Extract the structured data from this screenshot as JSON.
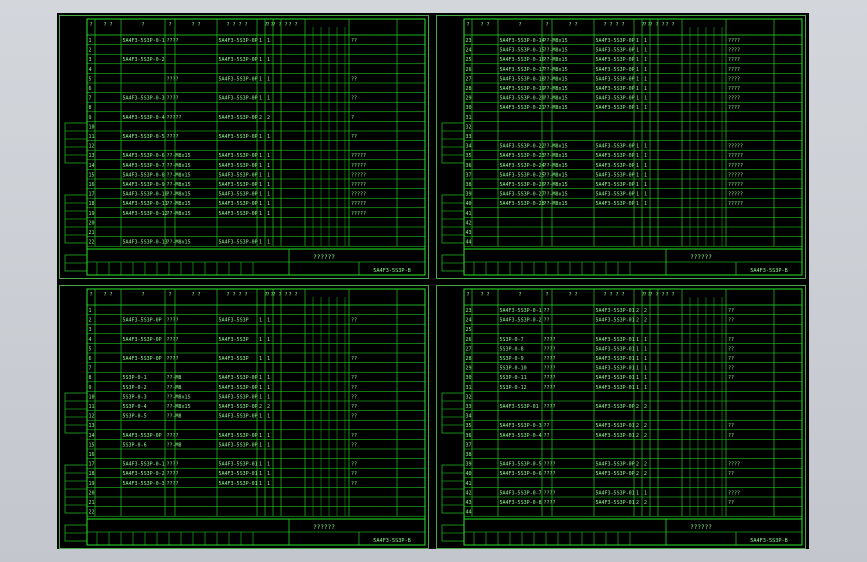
{
  "app": {
    "background_color": "#c7cbd1",
    "canvas_color": "#000000",
    "line_color": "#27e827",
    "text_color": "#8cff8c",
    "frame_color": "#4aa84a"
  },
  "sheets": [
    {
      "id": "top-left",
      "title_code": "??????",
      "drawing_no": "5A4F3-5S3P-B",
      "header": [
        "?",
        "? ?",
        "?",
        "?",
        "? ?",
        "? ? ? ?",
        "",
        "? ?",
        "? ? ? ?",
        "? ?"
      ],
      "rows": [
        {
          "n": "1",
          "code": "5A4F3-5S3P-0-1",
          "qty1": "????",
          "mat": "5A4F3-5S3P-0P",
          "a": "1",
          "b": "1",
          "note": "??"
        },
        {
          "n": "2",
          "code": "",
          "qty1": "",
          "mat": "",
          "a": "",
          "b": "",
          "note": ""
        },
        {
          "n": "3",
          "code": "5A4F3-5S3P-0-2",
          "qty1": "",
          "mat": "5A4F3-5S3P-0P",
          "a": "1",
          "b": "1",
          "note": ""
        },
        {
          "n": "4",
          "code": "",
          "qty1": "",
          "mat": "",
          "a": "",
          "b": "",
          "note": ""
        },
        {
          "n": "5",
          "code": "",
          "qty1": "????",
          "mat": "5A4F3-5S3P-0P",
          "a": "1",
          "b": "1",
          "note": "??"
        },
        {
          "n": "6",
          "code": "",
          "qty1": "",
          "mat": "",
          "a": "",
          "b": "",
          "note": ""
        },
        {
          "n": "7",
          "code": "5A4F3-5S3P-0-3",
          "qty1": "????",
          "mat": "5A4F3-5S3P-0P",
          "a": "1",
          "b": "1",
          "note": "??"
        },
        {
          "n": "8",
          "code": "",
          "qty1": "",
          "mat": "",
          "a": "",
          "b": "",
          "note": ""
        },
        {
          "n": "9",
          "code": "5A4F3-5S3P-0-4",
          "qty1": "?????",
          "mat": "5A4F3-5S3P-0P",
          "a": "2",
          "b": "2",
          "note": "?"
        },
        {
          "n": "10",
          "code": "",
          "qty1": "",
          "mat": "",
          "a": "",
          "b": "",
          "note": ""
        },
        {
          "n": "11",
          "code": "5A4F3-5S3P-0-5",
          "qty1": "????",
          "mat": "5A4F3-5S3P-0P",
          "a": "1",
          "b": "1",
          "note": "??"
        },
        {
          "n": "12",
          "code": "",
          "qty1": "",
          "mat": "",
          "a": "",
          "b": "",
          "note": ""
        },
        {
          "n": "13",
          "code": "5A4F3-5S3P-0-6",
          "qty1": "??-M8x15",
          "mat": "5A4F3-5S3P-0P",
          "a": "1",
          "b": "1",
          "note": "?????"
        },
        {
          "n": "14",
          "code": "5A4F3-5S3P-0-7",
          "qty1": "??-M8x15",
          "mat": "5A4F3-5S3P-0P",
          "a": "1",
          "b": "1",
          "note": "?????"
        },
        {
          "n": "15",
          "code": "5A4F3-5S3P-0-8",
          "qty1": "??-M8x15",
          "mat": "5A4F3-5S3P-0P",
          "a": "1",
          "b": "1",
          "note": "?????"
        },
        {
          "n": "16",
          "code": "5A4F3-5S3P-0-9",
          "qty1": "??-M8x15",
          "mat": "5A4F3-5S3P-0P",
          "a": "1",
          "b": "1",
          "note": "?????"
        },
        {
          "n": "17",
          "code": "5A4F3-5S3P-0-10",
          "qty1": "??-M8x15",
          "mat": "5A4F3-5S3P-0P",
          "a": "1",
          "b": "1",
          "note": "?????"
        },
        {
          "n": "18",
          "code": "5A4F3-5S3P-0-11",
          "qty1": "??-M8x15",
          "mat": "5A4F3-5S3P-0P",
          "a": "1",
          "b": "1",
          "note": "?????"
        },
        {
          "n": "19",
          "code": "5A4F3-5S3P-0-12",
          "qty1": "??-M8x15",
          "mat": "5A4F3-5S3P-0P",
          "a": "1",
          "b": "1",
          "note": "?????"
        },
        {
          "n": "20",
          "code": "",
          "qty1": "",
          "mat": "",
          "a": "",
          "b": "",
          "note": ""
        },
        {
          "n": "21",
          "code": "",
          "qty1": "",
          "mat": "",
          "a": "",
          "b": "",
          "note": ""
        },
        {
          "n": "22",
          "code": "5A4F3-5S3P-0-13",
          "qty1": "??-M8x15",
          "mat": "5A4F3-5S3P-0P",
          "a": "1",
          "b": "1",
          "note": ""
        }
      ]
    },
    {
      "id": "top-right",
      "title_code": "??????",
      "drawing_no": "5A4F3-5S3P-B",
      "header": [
        "?",
        "? ?",
        "?",
        "?",
        "? ?",
        "? ? ? ?",
        "",
        "? ?",
        "? ? ? ?",
        "? ?"
      ],
      "rows": [
        {
          "n": "23",
          "code": "5A4F3-5S3P-0-14",
          "qty1": "??-M8x15",
          "mat": "5A4F3-5S3P-0P",
          "a": "1",
          "b": "1",
          "note": "????"
        },
        {
          "n": "24",
          "code": "5A4F3-5S3P-0-15",
          "qty1": "??-M8x15",
          "mat": "5A4F3-5S3P-0P",
          "a": "1",
          "b": "1",
          "note": "????"
        },
        {
          "n": "25",
          "code": "5A4F3-5S3P-0-16",
          "qty1": "??-M8x15",
          "mat": "5A4F3-5S3P-0P",
          "a": "1",
          "b": "1",
          "note": "????"
        },
        {
          "n": "26",
          "code": "5A4F3-5S3P-0-17",
          "qty1": "??-M8x15",
          "mat": "5A4F3-5S3P-0P",
          "a": "1",
          "b": "1",
          "note": "????"
        },
        {
          "n": "27",
          "code": "5A4F3-5S3P-0-18",
          "qty1": "??-M8x15",
          "mat": "5A4F3-5S3P-0P",
          "a": "1",
          "b": "1",
          "note": "????"
        },
        {
          "n": "28",
          "code": "5A4F3-5S3P-0-19",
          "qty1": "??-M8x15",
          "mat": "5A4F3-5S3P-0P",
          "a": "1",
          "b": "1",
          "note": "????"
        },
        {
          "n": "29",
          "code": "5A4F3-5S3P-0-20",
          "qty1": "??-M8x15",
          "mat": "5A4F3-5S3P-0P",
          "a": "1",
          "b": "1",
          "note": "????"
        },
        {
          "n": "30",
          "code": "5A4F3-5S3P-0-21",
          "qty1": "??-M8x15",
          "mat": "5A4F3-5S3P-0P",
          "a": "1",
          "b": "1",
          "note": "????"
        },
        {
          "n": "31",
          "code": "",
          "qty1": "",
          "mat": "",
          "a": "",
          "b": "",
          "note": ""
        },
        {
          "n": "32",
          "code": "",
          "qty1": "",
          "mat": "",
          "a": "",
          "b": "",
          "note": ""
        },
        {
          "n": "33",
          "code": "",
          "qty1": "",
          "mat": "",
          "a": "",
          "b": "",
          "note": ""
        },
        {
          "n": "34",
          "code": "5A4F3-5S3P-0-22",
          "qty1": "??-M8x15",
          "mat": "5A4F3-5S3P-0P",
          "a": "1",
          "b": "1",
          "note": "?????"
        },
        {
          "n": "35",
          "code": "5A4F3-5S3P-0-23",
          "qty1": "??-M8x15",
          "mat": "5A4F3-5S3P-0P",
          "a": "1",
          "b": "1",
          "note": "?????"
        },
        {
          "n": "36",
          "code": "5A4F3-5S3P-0-24",
          "qty1": "??-M8x15",
          "mat": "5A4F3-5S3P-0P",
          "a": "1",
          "b": "1",
          "note": "?????"
        },
        {
          "n": "37",
          "code": "5A4F3-5S3P-0-25",
          "qty1": "??-M8x15",
          "mat": "5A4F3-5S3P-0P",
          "a": "1",
          "b": "1",
          "note": "?????"
        },
        {
          "n": "38",
          "code": "5A4F3-5S3P-0-26",
          "qty1": "??-M8x15",
          "mat": "5A4F3-5S3P-0P",
          "a": "1",
          "b": "1",
          "note": "?????"
        },
        {
          "n": "39",
          "code": "5A4F3-5S3P-0-27",
          "qty1": "??-M8x15",
          "mat": "5A4F3-5S3P-0P",
          "a": "1",
          "b": "1",
          "note": "?????"
        },
        {
          "n": "40",
          "code": "5A4F3-5S3P-0-28",
          "qty1": "??-M8x15",
          "mat": "5A4F3-5S3P-0P",
          "a": "1",
          "b": "1",
          "note": "?????"
        },
        {
          "n": "41",
          "code": "",
          "qty1": "",
          "mat": "",
          "a": "",
          "b": "",
          "note": ""
        },
        {
          "n": "42",
          "code": "",
          "qty1": "",
          "mat": "",
          "a": "",
          "b": "",
          "note": ""
        },
        {
          "n": "43",
          "code": "",
          "qty1": "",
          "mat": "",
          "a": "",
          "b": "",
          "note": ""
        },
        {
          "n": "44",
          "code": "",
          "qty1": "",
          "mat": "",
          "a": "",
          "b": "",
          "note": ""
        }
      ]
    },
    {
      "id": "bottom-left",
      "title_code": "??????",
      "drawing_no": "5A4F3-5S3P-B",
      "header": [
        "?",
        "? ?",
        "?",
        "?",
        "? ?",
        "? ? ? ?",
        "",
        "? ?",
        "? ? ? ?",
        "? ?"
      ],
      "rows": [
        {
          "n": "1",
          "code": "",
          "qty1": "",
          "mat": "",
          "a": "",
          "b": "",
          "note": ""
        },
        {
          "n": "2",
          "code": "5A4F3-5S3P-0P",
          "qty1": "????",
          "mat": "5A4F3-5S3P",
          "a": "1",
          "b": "1",
          "note": "??"
        },
        {
          "n": "3",
          "code": "",
          "qty1": "",
          "mat": "",
          "a": "",
          "b": "",
          "note": ""
        },
        {
          "n": "4",
          "code": "5A4F3-5S3P-0P",
          "qty1": "????",
          "mat": "5A4F3-5S3P",
          "a": "1",
          "b": "1",
          "note": ""
        },
        {
          "n": "5",
          "code": "",
          "qty1": "",
          "mat": "",
          "a": "",
          "b": "",
          "note": ""
        },
        {
          "n": "6",
          "code": "5A4F3-5S3P-0P",
          "qty1": "????",
          "mat": "5A4F3-5S3P",
          "a": "1",
          "b": "1",
          "note": "??"
        },
        {
          "n": "7",
          "code": "",
          "qty1": "",
          "mat": "",
          "a": "",
          "b": "",
          "note": ""
        },
        {
          "n": "8",
          "code": "5S3P-0-1",
          "qty1": "??-M8",
          "mat": "5A4F3-5S3P-0P",
          "a": "1",
          "b": "1",
          "note": "??"
        },
        {
          "n": "9",
          "code": "5S3P-0-2",
          "qty1": "??-M8",
          "mat": "5A4F3-5S3P-0P",
          "a": "1",
          "b": "1",
          "note": "??"
        },
        {
          "n": "10",
          "code": "5S3P-0-3",
          "qty1": "??-M8x15",
          "mat": "5A4F3-5S3P-0P",
          "a": "1",
          "b": "1",
          "note": "??"
        },
        {
          "n": "11",
          "code": "5S3P-0-4",
          "qty1": "??-M8x15",
          "mat": "5A4F3-5S3P-0P",
          "a": "2",
          "b": "2",
          "note": "??"
        },
        {
          "n": "12",
          "code": "5S3P-0-5",
          "qty1": "??-M8",
          "mat": "5A4F3-5S3P-0P",
          "a": "1",
          "b": "1",
          "note": "??"
        },
        {
          "n": "13",
          "code": "",
          "qty1": "",
          "mat": "",
          "a": "",
          "b": "",
          "note": ""
        },
        {
          "n": "14",
          "code": "5A4F3-5S3P-0P",
          "qty1": "????",
          "mat": "5A4F3-5S3P-0P",
          "a": "1",
          "b": "1",
          "note": "??"
        },
        {
          "n": "15",
          "code": "5S3P-0-6",
          "qty1": "??-M8",
          "mat": "5A4F3-5S3P-0P",
          "a": "1",
          "b": "1",
          "note": "??"
        },
        {
          "n": "16",
          "code": "",
          "qty1": "",
          "mat": "",
          "a": "",
          "b": "",
          "note": ""
        },
        {
          "n": "17",
          "code": "5A4F3-5S3P-0-1",
          "qty1": "????",
          "mat": "5A4F3-5S3P-01",
          "a": "1",
          "b": "1",
          "note": "??"
        },
        {
          "n": "18",
          "code": "5A4F3-5S3P-0-2",
          "qty1": "????",
          "mat": "5A4F3-5S3P-01",
          "a": "1",
          "b": "1",
          "note": "??"
        },
        {
          "n": "19",
          "code": "5A4F3-5S3P-0-3",
          "qty1": "????",
          "mat": "5A4F3-5S3P-01",
          "a": "1",
          "b": "1",
          "note": "??"
        },
        {
          "n": "20",
          "code": "",
          "qty1": "",
          "mat": "",
          "a": "",
          "b": "",
          "note": ""
        },
        {
          "n": "21",
          "code": "",
          "qty1": "",
          "mat": "",
          "a": "",
          "b": "",
          "note": ""
        },
        {
          "n": "22",
          "code": "",
          "qty1": "",
          "mat": "",
          "a": "",
          "b": "",
          "note": ""
        }
      ]
    },
    {
      "id": "bottom-right",
      "title_code": "??????",
      "drawing_no": "5A4F3-5S3P-B",
      "header": [
        "?",
        "? ?",
        "?",
        "?",
        "? ?",
        "? ? ? ?",
        "",
        "? ?",
        "? ? ? ?",
        "? ?"
      ],
      "rows": [
        {
          "n": "23",
          "code": "5A4F3-5S3P-0-1",
          "qty1": "??",
          "mat": "5A4F3-5S3P-01",
          "a": "2",
          "b": "2",
          "note": "??"
        },
        {
          "n": "24",
          "code": "5A4F3-5S3P-0-2",
          "qty1": "??",
          "mat": "5A4F3-5S3P-01",
          "a": "2",
          "b": "2",
          "note": "??"
        },
        {
          "n": "25",
          "code": "",
          "qty1": "",
          "mat": "",
          "a": "",
          "b": "",
          "note": ""
        },
        {
          "n": "26",
          "code": "5S3P-0-7",
          "qty1": "????",
          "mat": "5A4F3-5S3P-01",
          "a": "1",
          "b": "1",
          "note": "??"
        },
        {
          "n": "27",
          "code": "5S3P-0-8",
          "qty1": "????",
          "mat": "5A4F3-5S3P-01",
          "a": "1",
          "b": "1",
          "note": "??"
        },
        {
          "n": "28",
          "code": "5S3P-0-9",
          "qty1": "????",
          "mat": "5A4F3-5S3P-01",
          "a": "1",
          "b": "1",
          "note": "??"
        },
        {
          "n": "29",
          "code": "5S3P-0-10",
          "qty1": "????",
          "mat": "5A4F3-5S3P-01",
          "a": "1",
          "b": "1",
          "note": "??"
        },
        {
          "n": "30",
          "code": "5S3P-0-11",
          "qty1": "????",
          "mat": "5A4F3-5S3P-01",
          "a": "1",
          "b": "1",
          "note": "??"
        },
        {
          "n": "31",
          "code": "5S3P-0-12",
          "qty1": "????",
          "mat": "5A4F3-5S3P-01",
          "a": "1",
          "b": "1",
          "note": ""
        },
        {
          "n": "32",
          "code": "",
          "qty1": "",
          "mat": "",
          "a": "",
          "b": "",
          "note": ""
        },
        {
          "n": "33",
          "code": "5A4F3-5S3P-01",
          "qty1": "????",
          "mat": "5A4F3-5S3P-0P",
          "a": "2",
          "b": "2",
          "note": ""
        },
        {
          "n": "34",
          "code": "",
          "qty1": "",
          "mat": "",
          "a": "",
          "b": "",
          "note": ""
        },
        {
          "n": "35",
          "code": "5A4F3-5S3P-0-3",
          "qty1": "??",
          "mat": "5A4F3-5S3P-01",
          "a": "2",
          "b": "2",
          "note": "??"
        },
        {
          "n": "36",
          "code": "5A4F3-5S3P-0-4",
          "qty1": "??",
          "mat": "5A4F3-5S3P-01",
          "a": "2",
          "b": "2",
          "note": "??"
        },
        {
          "n": "37",
          "code": "",
          "qty1": "",
          "mat": "",
          "a": "",
          "b": "",
          "note": ""
        },
        {
          "n": "38",
          "code": "",
          "qty1": "",
          "mat": "",
          "a": "",
          "b": "",
          "note": ""
        },
        {
          "n": "39",
          "code": "5A4F3-5S3P-0-5",
          "qty1": "????",
          "mat": "5A4F3-5S3P-0P",
          "a": "2",
          "b": "2",
          "note": "????"
        },
        {
          "n": "40",
          "code": "5A4F3-5S3P-0-6",
          "qty1": "????",
          "mat": "5A4F3-5S3P-0P",
          "a": "2",
          "b": "2",
          "note": "??"
        },
        {
          "n": "41",
          "code": "",
          "qty1": "",
          "mat": "",
          "a": "",
          "b": "",
          "note": ""
        },
        {
          "n": "42",
          "code": "5A4F3-5S3P-0-7",
          "qty1": "????",
          "mat": "5A4F3-5S3P-01",
          "a": "1",
          "b": "1",
          "note": "????"
        },
        {
          "n": "43",
          "code": "5A4F3-5S3P-0-8",
          "qty1": "????",
          "mat": "5A4F3-5S3P-01",
          "a": "2",
          "b": "2",
          "note": "??"
        },
        {
          "n": "44",
          "code": "",
          "qty1": "",
          "mat": "",
          "a": "",
          "b": "",
          "note": ""
        }
      ]
    }
  ]
}
